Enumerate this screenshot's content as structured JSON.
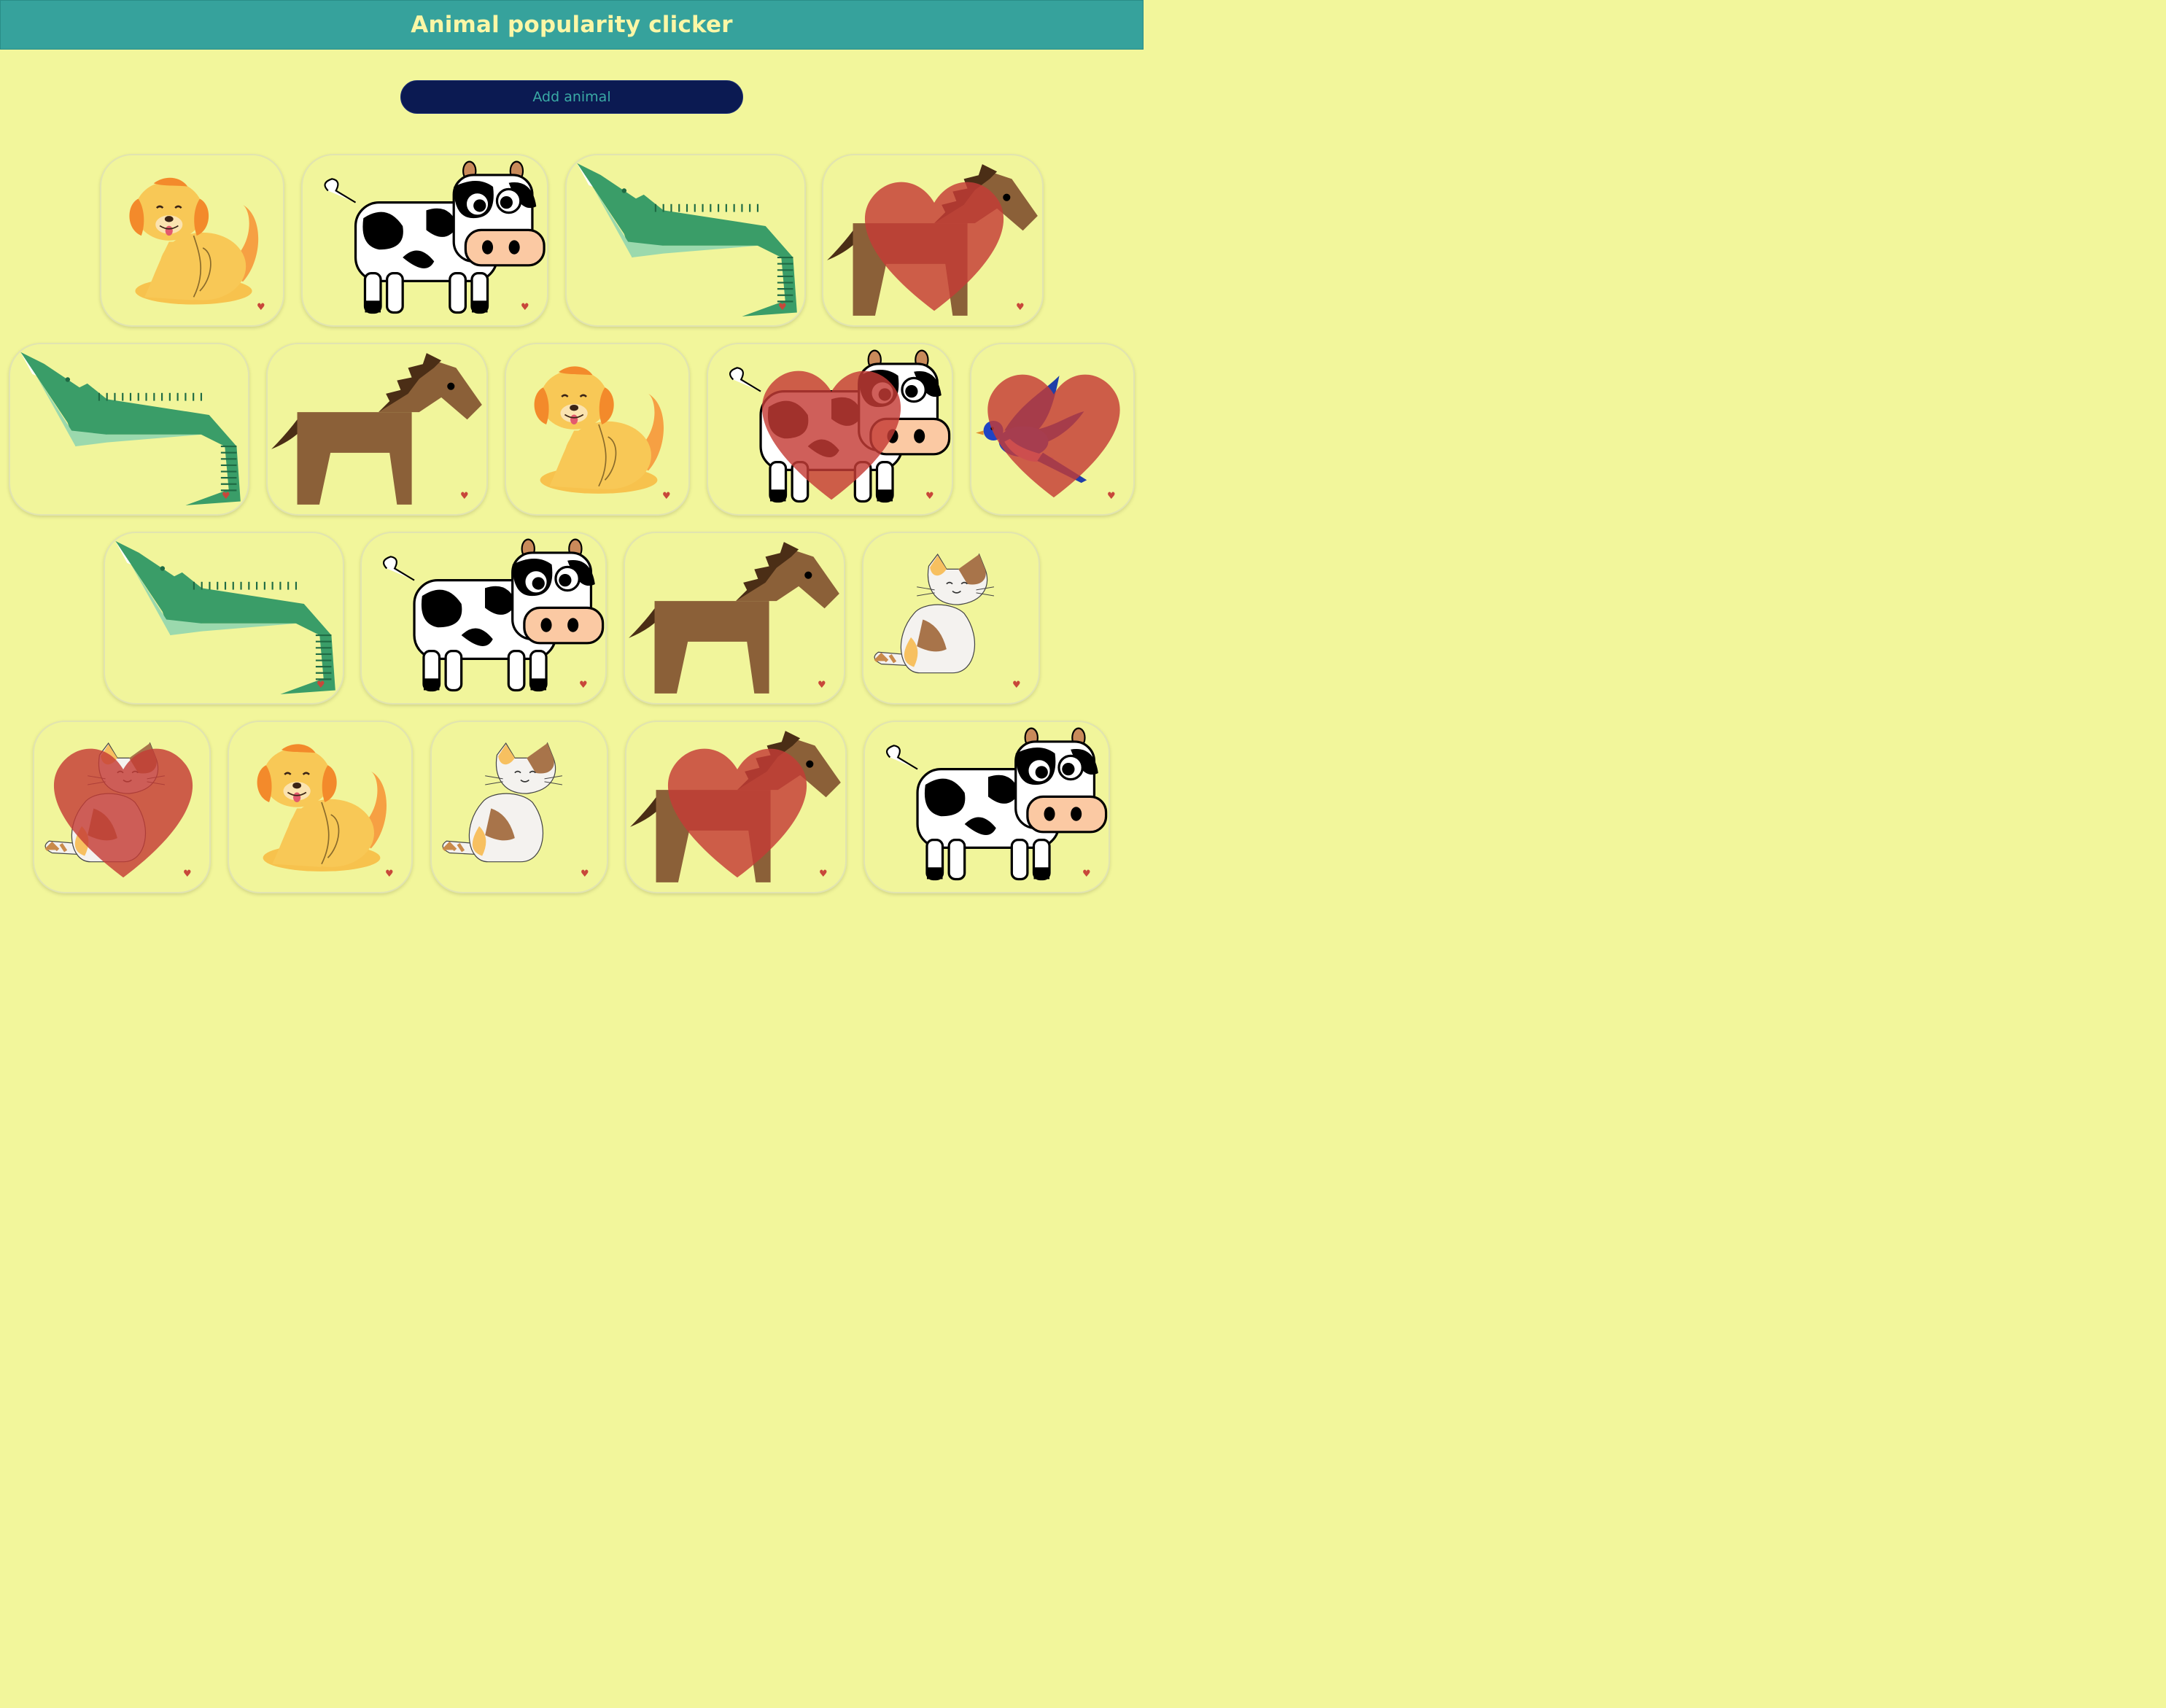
{
  "app": {
    "title": "Animal popularity clicker"
  },
  "toolbar": {
    "add_label": "Add animal"
  },
  "colors": {
    "background": "#f2f69b",
    "header": "#36a29c",
    "title_text": "#fbf7a6",
    "button": "#0b1a52",
    "button_text": "#3aaaa5",
    "heart": "#c8473a"
  },
  "cards": [
    {
      "animal": "dog",
      "liked": false
    },
    {
      "animal": "cow",
      "liked": false
    },
    {
      "animal": "crocodile",
      "liked": false
    },
    {
      "animal": "horse",
      "liked": true
    },
    {
      "animal": "crocodile",
      "liked": false
    },
    {
      "animal": "horse",
      "liked": false
    },
    {
      "animal": "dog",
      "liked": false
    },
    {
      "animal": "cow",
      "liked": true
    },
    {
      "animal": "bird",
      "liked": true
    },
    {
      "animal": "crocodile",
      "liked": false
    },
    {
      "animal": "cow",
      "liked": false
    },
    {
      "animal": "horse",
      "liked": false
    },
    {
      "animal": "cat",
      "liked": false
    },
    {
      "animal": "cat",
      "liked": true
    },
    {
      "animal": "dog",
      "liked": false
    },
    {
      "animal": "cat",
      "liked": false
    },
    {
      "animal": "horse",
      "liked": true
    },
    {
      "animal": "cow",
      "liked": false
    }
  ]
}
